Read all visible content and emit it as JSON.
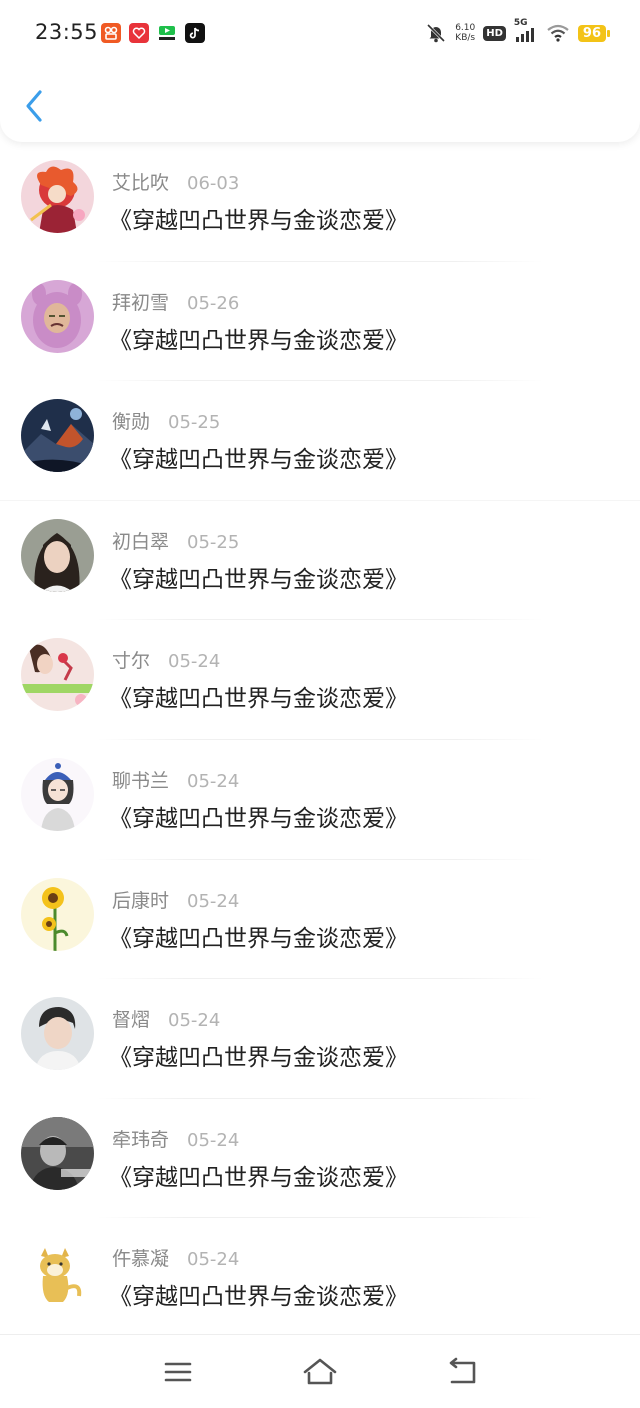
{
  "status_bar": {
    "time": "23:55",
    "net_speed_value": "6.10",
    "net_speed_unit": "KB/s",
    "hd_label": "HD",
    "network_label": "5G",
    "battery": "96"
  },
  "colors": {
    "accent": "#3b9eea",
    "name_text": "#8a8a8a",
    "date_text": "#b3b3b3",
    "battery": "#f3c317"
  },
  "comments": [
    {
      "name": "艾比吹",
      "date": "06-03",
      "content": "《穿越凹凸世界与金谈恋爱》"
    },
    {
      "name": "拜初雪",
      "date": "05-26",
      "content": "《穿越凹凸世界与金谈恋爱》"
    },
    {
      "name": "衡勋",
      "date": "05-25",
      "content": "《穿越凹凸世界与金谈恋爱》"
    },
    {
      "name": "初白翠",
      "date": "05-25",
      "content": "《穿越凹凸世界与金谈恋爱》"
    },
    {
      "name": "寸尔",
      "date": "05-24",
      "content": "《穿越凹凸世界与金谈恋爱》"
    },
    {
      "name": "聊书兰",
      "date": "05-24",
      "content": "《穿越凹凸世界与金谈恋爱》"
    },
    {
      "name": "后康时",
      "date": "05-24",
      "content": "《穿越凹凸世界与金谈恋爱》"
    },
    {
      "name": "督熠",
      "date": "05-24",
      "content": "《穿越凹凸世界与金谈恋爱》"
    },
    {
      "name": "牵玮奇",
      "date": "05-24",
      "content": "《穿越凹凸世界与金谈恋爱》"
    },
    {
      "name": "仵慕凝",
      "date": "05-24",
      "content": "《穿越凹凸世界与金谈恋爱》"
    }
  ],
  "nav_icons": [
    "menu-icon",
    "home-icon",
    "back-icon"
  ]
}
